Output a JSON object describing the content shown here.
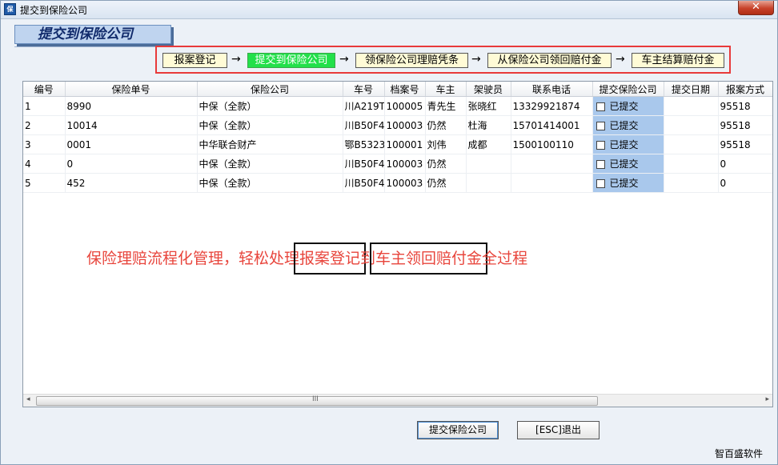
{
  "window": {
    "title": "提交到保险公司",
    "close_label": "✕"
  },
  "header": {
    "title": "提交到保险公司"
  },
  "flow": {
    "steps": [
      "报案登记",
      "提交到保险公司",
      "领保险公司理赔凭条",
      "从保险公司领回赔付金",
      "车主结算赔付金"
    ],
    "arrow": "→",
    "active_step": 1
  },
  "table": {
    "columns": [
      "编号",
      "保险单号",
      "保险公司",
      "车号",
      "档案号",
      "车主",
      "架驶员",
      "联系电话",
      "提交保险公司",
      "提交日期",
      "报案方式"
    ],
    "rows": [
      {
        "id": "1",
        "policy_no": "8990",
        "company": "中保（全款）",
        "plate": "川A219T",
        "file_no": "100005",
        "owner": "青先生",
        "driver": "张晓红",
        "phone": "13329921874",
        "submitted": "已提交",
        "submit_date": "",
        "report_method": "95518"
      },
      {
        "id": "2",
        "policy_no": "10014",
        "company": "中保（全款）",
        "plate": "川B50F4",
        "file_no": "100003",
        "owner": "仍然",
        "driver": "杜海",
        "phone": "15701414001",
        "submitted": "已提交",
        "submit_date": "",
        "report_method": "95518"
      },
      {
        "id": "3",
        "policy_no": "0001",
        "company": "中华联合财产",
        "plate": "鄂B5323",
        "file_no": "100001",
        "owner": "刘伟",
        "driver": "成都",
        "phone": "1500100110",
        "submitted": "已提交",
        "submit_date": "",
        "report_method": "95518"
      },
      {
        "id": "4",
        "policy_no": "0",
        "company": "中保（全款）",
        "plate": "川B50F4",
        "file_no": "100003",
        "owner": "仍然",
        "driver": "",
        "phone": "",
        "submitted": "已提交",
        "submit_date": "",
        "report_method": "0"
      },
      {
        "id": "5",
        "policy_no": "452",
        "company": "中保（全款）",
        "plate": "川B50F4",
        "file_no": "100003",
        "owner": "仍然",
        "driver": "",
        "phone": "",
        "submitted": "已提交",
        "submit_date": "",
        "report_method": "0"
      }
    ]
  },
  "scrollbar": {
    "left_arrow": "◂",
    "right_arrow": "▸",
    "grip": "III"
  },
  "banner": {
    "part1": "保险理赔流程化管理，轻松处理",
    "highlight1": "报案登记",
    "part2": "到",
    "highlight2": "车主领回赔付金",
    "part3": "全过程"
  },
  "buttons": {
    "submit": "提交保险公司",
    "exit": "[ESC]退出"
  },
  "footer": {
    "brand": "智百盛软件"
  },
  "colors": {
    "accent_green": "#22e04a",
    "highlight_red": "#e83a3a",
    "banner_text": "#e8453c",
    "submitted_cell": "#a9c8ec"
  }
}
